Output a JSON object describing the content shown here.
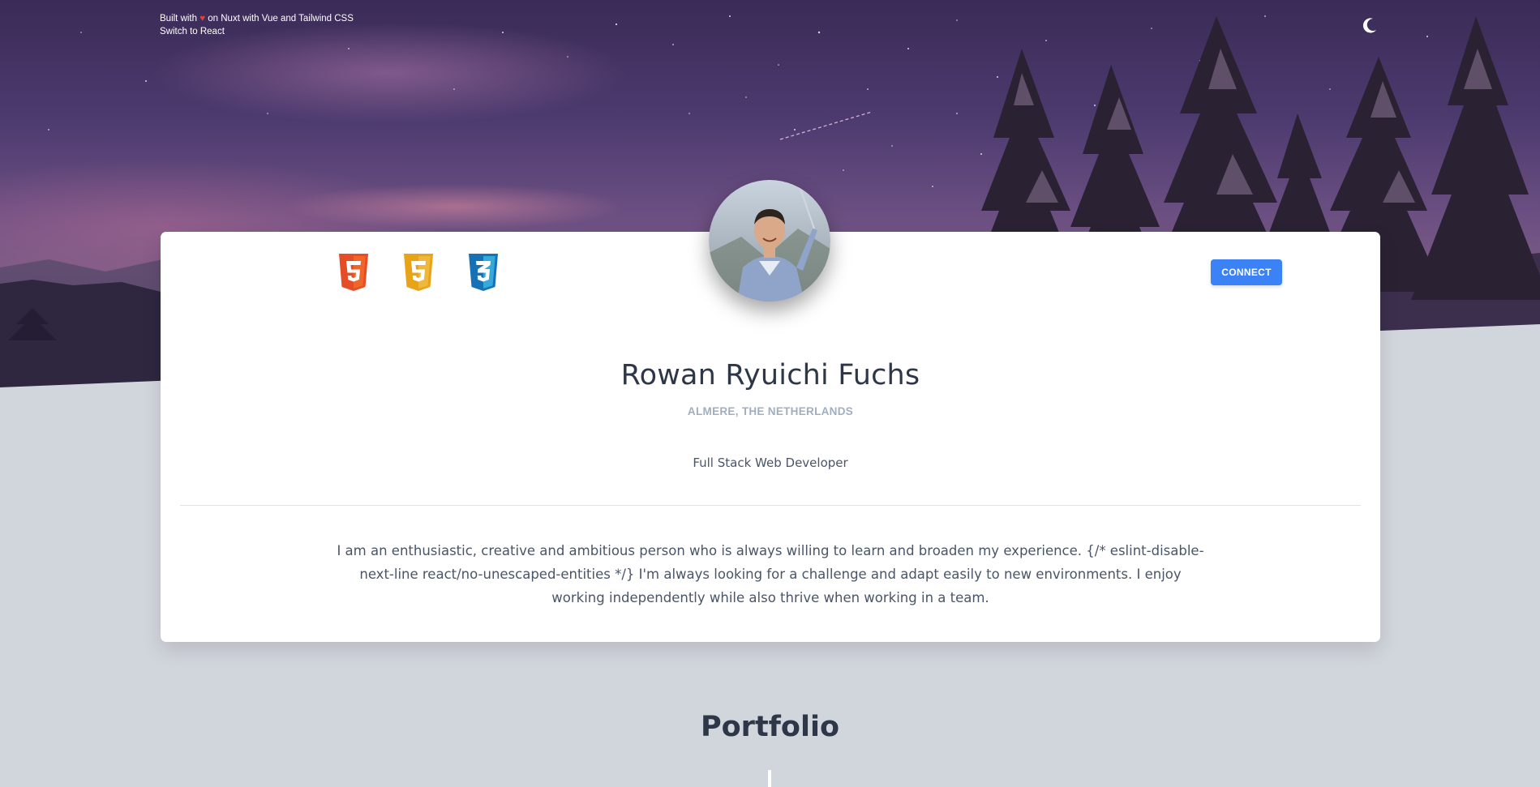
{
  "header": {
    "built_prefix": "Built with",
    "heart": "♥",
    "built_suffix": "on Nuxt with Vue and Tailwind CSS",
    "switch_link": "Switch to React",
    "theme_toggle_icon": "moon-icon"
  },
  "profile": {
    "tech_icons": [
      "html5-icon",
      "javascript-icon",
      "css3-icon"
    ],
    "connect_label": "CONNECT",
    "name": "Rowan Ryuichi Fuchs",
    "location": "ALMERE, THE NETHERLANDS",
    "role": "Full Stack Web Developer",
    "bio": "I am an enthusiastic, creative and ambitious person who is always willing to learn and broaden my experience. {/* eslint-disable-next-line react/no-unescaped-entities */} I'm always looking for a challenge and adapt easily to new environments. I enjoy working independently while also thrive when working in a team."
  },
  "portfolio": {
    "title": "Portfolio"
  },
  "colors": {
    "accent": "#3b82f6",
    "heart": "#e53e3e",
    "background": "#d1d5dc",
    "html5": "#e44d26",
    "javascript": "#e8a317",
    "css3": "#1572b6"
  }
}
